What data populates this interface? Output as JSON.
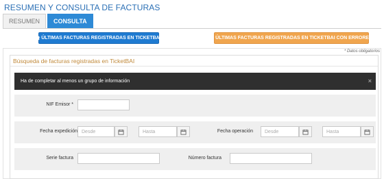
{
  "page": {
    "title": "RESUMEN Y CONSULTA DE FACTURAS"
  },
  "tabs": [
    {
      "label": "RESUMEN"
    },
    {
      "label": "CONSULTA"
    }
  ],
  "actions": {
    "registered_label": "ÚLTIMAS FACTURAS REGISTRADAS EN TICKETBAI",
    "errors_label": "ÚLTIMAS FACTURAS REGISTRADAS EN TICKETBAI CON ERRORES"
  },
  "required_note": "* Datos obligatorios",
  "search": {
    "heading": "Búsqueda de facturas registradas en TicketBAI",
    "alert": "Ha de completar al menos un grupo de información",
    "alert_close": "×",
    "fields": {
      "nif_label": "NIF Emisor *",
      "nif_value": "",
      "fecha_expedicion_label": "Fecha expedición",
      "fecha_operacion_label": "Fecha operación",
      "desde_placeholder": "Desde",
      "hasta_placeholder": "Hasta",
      "serie_label": "Serie factura",
      "numero_label": "Número factura"
    }
  },
  "colors": {
    "accent": "#2a6fb5",
    "primary_button": "#1f7bd1",
    "warning_button": "#f0a54e",
    "alert_bg": "#2f2f2f",
    "heading": "#c0893a"
  },
  "icons": {
    "button_icon": "upload-icon",
    "date_picker_icon": "calendar-icon",
    "close": "close-icon"
  }
}
